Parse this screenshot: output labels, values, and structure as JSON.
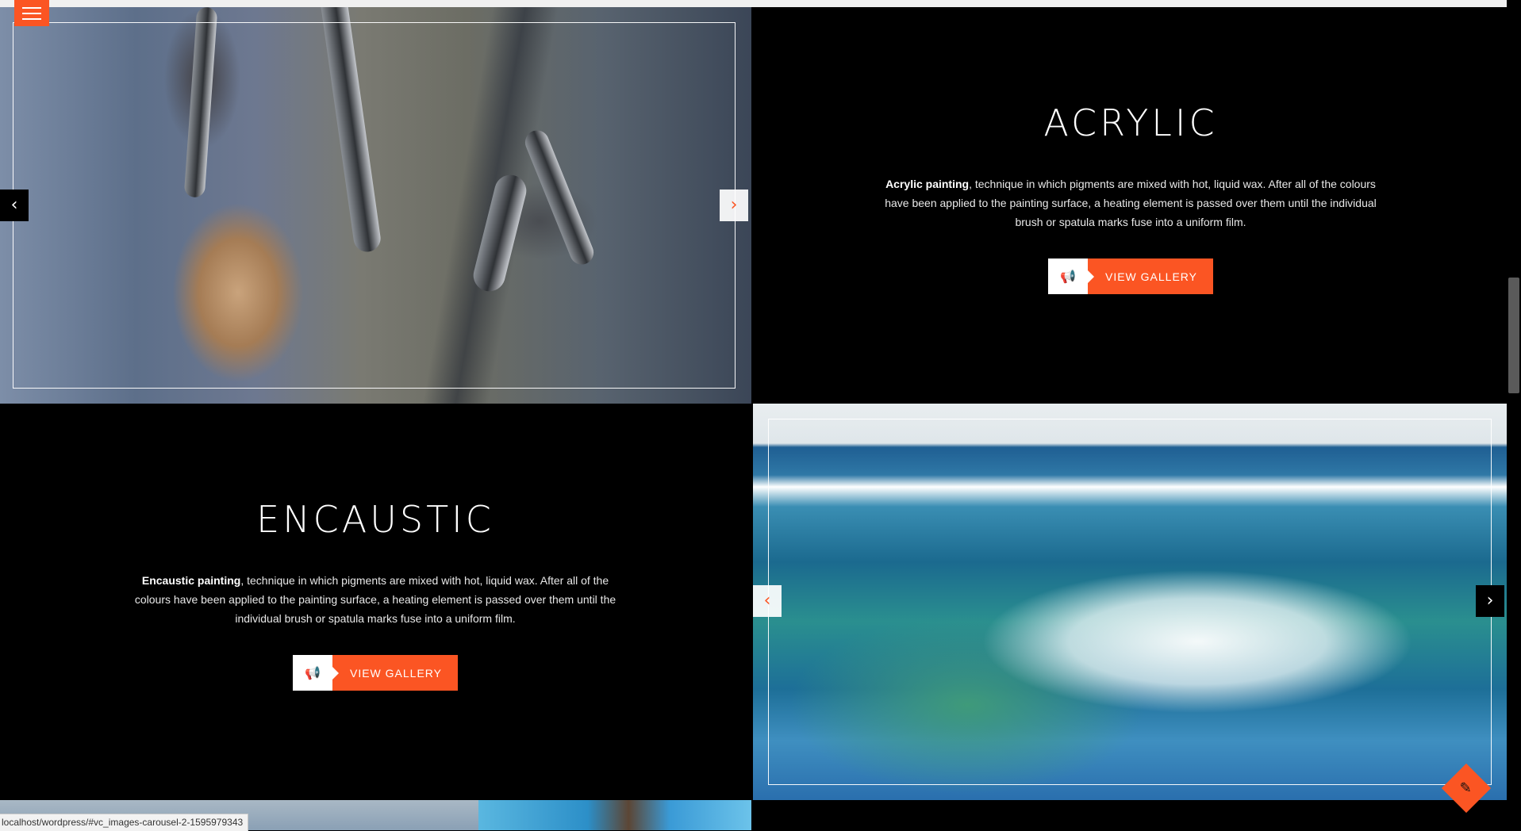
{
  "menu": {
    "icon": "hamburger-icon"
  },
  "sections": [
    {
      "title": "ACRYLIC",
      "description_bold": "Acrylic painting",
      "description_rest": ", technique in which pigments are mixed with hot, liquid wax. After all of the colours have been applied to the painting surface, a heating element is passed over them until the individual brush or spatula marks fuse into a uniform film.",
      "button_label": "VIEW GALLERY",
      "button_icon": "megaphone-icon"
    },
    {
      "title": "ENCAUSTIC",
      "description_bold": "Encaustic painting",
      "description_rest": ", technique in which pigments are mixed with hot, liquid wax. After all of the colours have been applied to the painting surface, a heating element is passed over them until the individual brush or spatula marks fuse into a uniform film.",
      "button_label": "VIEW GALLERY",
      "button_icon": "megaphone-icon"
    }
  ],
  "carousel": {
    "prev_glyph": "‹",
    "next_glyph": "›"
  },
  "status_bar": {
    "url": "localhost/wordpress/#vc_images-carousel-2-1595979343"
  },
  "colors": {
    "accent": "#fb5523",
    "background": "#000000"
  },
  "fab": {
    "icon": "pen-nib-icon",
    "glyph": "✎"
  }
}
